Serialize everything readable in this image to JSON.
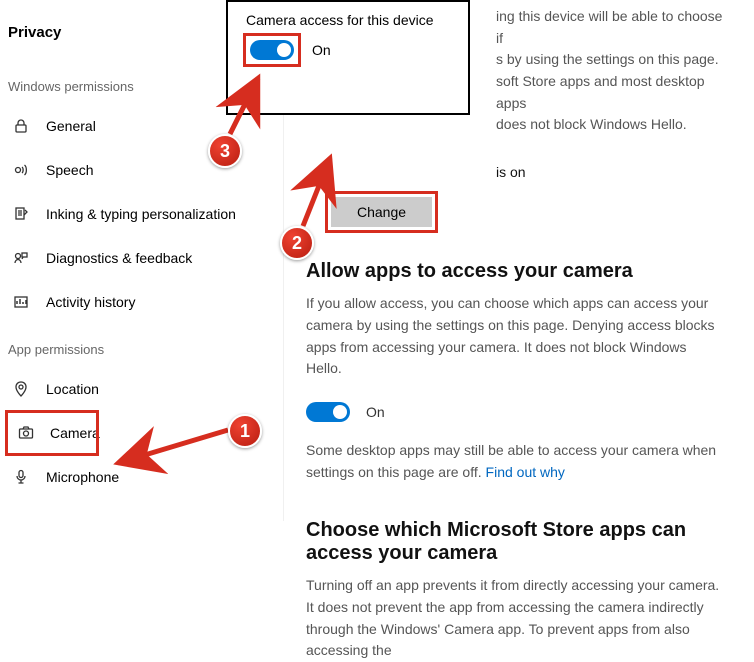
{
  "sidebar": {
    "title": "Privacy",
    "section_windows": "Windows permissions",
    "section_app": "App permissions",
    "items": {
      "general": "General",
      "speech": "Speech",
      "inking": "Inking & typing personalization",
      "diagnostics": "Diagnostics & feedback",
      "activity": "Activity history",
      "location": "Location",
      "camera": "Camera",
      "microphone": "Microphone"
    }
  },
  "popup": {
    "title": "Camera access for this device",
    "state": "On"
  },
  "content": {
    "partial_l1": "ing this device will be able to choose if",
    "partial_l2": "s by using the settings on this page.",
    "partial_l3": "soft Store apps and most desktop apps",
    "partial_l4": "does not block Windows Hello.",
    "status_suffix": "is on",
    "change": "Change",
    "allow_heading": "Allow apps to access your camera",
    "allow_desc": "If you allow access, you can choose which apps can access your camera by using the settings on this page. Denying access blocks apps from accessing your camera. It does not block Windows Hello.",
    "toggle_label": "On",
    "desktop_note_a": "Some desktop apps may still be able to access your camera when settings on this page are off. ",
    "desktop_note_link": "Find out why",
    "choose_heading": "Choose which Microsoft Store apps can access your camera",
    "choose_desc": "Turning off an app prevents it from directly accessing your camera. It does not prevent the app from accessing the camera indirectly through the Windows' Camera app. To prevent apps from also accessing the"
  },
  "badges": {
    "one": "1",
    "two": "2",
    "three": "3"
  }
}
